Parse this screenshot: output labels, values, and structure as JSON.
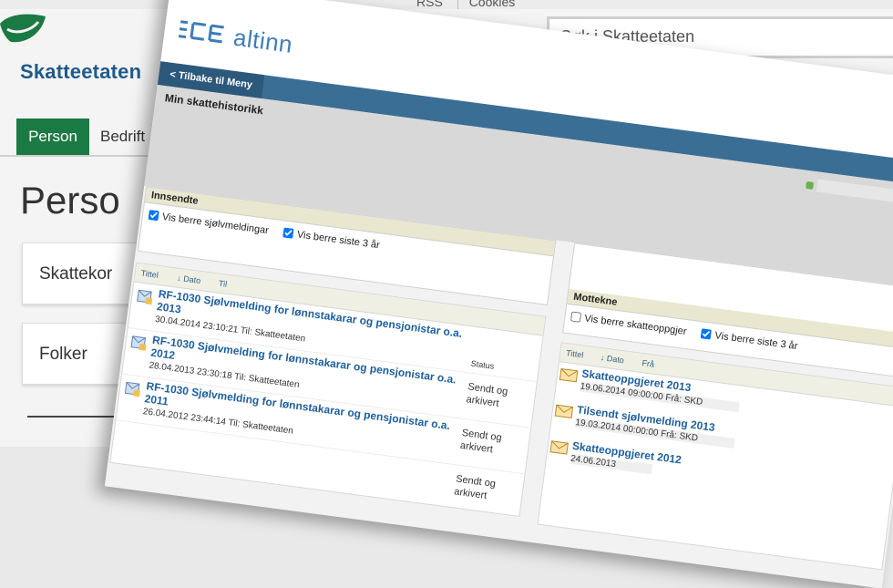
{
  "site": {
    "top_links": [
      "RSS",
      "Cookies"
    ],
    "logo_text": "Skatteetaten",
    "search_placeholder": "Søk i Skatteetaten",
    "nav": {
      "active": "Person",
      "other": "Bedrift"
    },
    "heading": "Perso",
    "cards": [
      "Skattekor",
      "Folker"
    ],
    "colors": {
      "brand_green": "#1b7a43",
      "brand_blue": "#1e5a8a"
    }
  },
  "altinn": {
    "logo_text": "altinn",
    "back_label": "< Tilbake til Meny",
    "page_title": "Min skattehistorikk",
    "sent": {
      "header": "Innsendte",
      "filters": [
        "Vis berre sjølvmeldingar",
        "Vis berre siste 3 år"
      ],
      "columns": {
        "title": "Tittel",
        "date": "↓ Dato",
        "to": "Til",
        "status": "Status"
      },
      "items": [
        {
          "title": "RF-1030 Sjølvmelding for lønnstakarar og pensjonistar o.a. 2013",
          "meta": "30.04.2014 23:10:21 Til: Skatteetaten",
          "status": "Sendt og arkivert"
        },
        {
          "title": "RF-1030 Sjølvmelding for lønnstakarar og pensjonistar o.a. 2012",
          "meta": "28.04.2013 23:30:18 Til: Skatteetaten",
          "status": "Sendt og arkivert"
        },
        {
          "title": "RF-1030 Sjølvmelding for lønnstakarar og pensjonistar o.a. 2011",
          "meta": "26.04.2012 23:44:14 Til: Skatteetaten",
          "status": "Sendt og arkivert"
        }
      ]
    },
    "received": {
      "header": "Mottekne",
      "filters": [
        "Vis berre skatteoppgjer",
        "Vis berre siste 3 år"
      ],
      "columns": {
        "title": "Tittel",
        "date": "↓ Dato",
        "from": "Frå"
      },
      "items": [
        {
          "title": "Skatteoppgjeret 2013",
          "meta": "19.06.2014 09:00:00 Frå: SKD"
        },
        {
          "title": "Tilsendt sjølvmelding 2013",
          "meta": "19.03.2014 00:00:00 Frå: SKD"
        },
        {
          "title": "Skatteoppgjeret 2012",
          "meta": "24.06.2013"
        }
      ]
    },
    "colors": {
      "nav_blue": "#3b6e94",
      "link_blue": "#1f5f9c",
      "logo_blue": "#3f7cb8"
    }
  }
}
